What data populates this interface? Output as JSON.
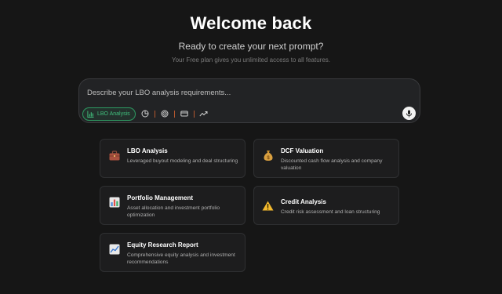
{
  "header": {
    "title": "Welcome back",
    "subtitle": "Ready to create your next prompt?",
    "plan_note": "Your Free plan gives you unlimited access to all features."
  },
  "prompt": {
    "placeholder": "Describe your LBO analysis requirements...",
    "value": "",
    "active_chip": "LBO Analysis",
    "chip_icon": "bar-chart-icon",
    "tool_icons": [
      "pie-chart-icon",
      "target-icon",
      "credit-card-icon",
      "trend-line-icon"
    ],
    "mic_icon": "microphone-icon"
  },
  "cards": [
    {
      "title": "LBO Analysis",
      "desc": "Leveraged buyout modeling and deal structuring",
      "icon": "briefcase-icon"
    },
    {
      "title": "DCF Valuation",
      "desc": "Discounted cash flow analysis and company valuation",
      "icon": "money-bag-icon"
    },
    {
      "title": "Portfolio Management",
      "desc": "Asset allocation and investment portfolio optimization",
      "icon": "bar-chart-icon"
    },
    {
      "title": "Credit Analysis",
      "desc": "Credit risk assessment and loan structuring",
      "icon": "warning-icon"
    },
    {
      "title": "Equity Research Report",
      "desc": "Comprehensive equity analysis and investment recommendations",
      "icon": "line-chart-icon"
    }
  ],
  "colors": {
    "background": "#161616",
    "accent_green": "#41c07d",
    "separator_orange": "#b5582e"
  }
}
